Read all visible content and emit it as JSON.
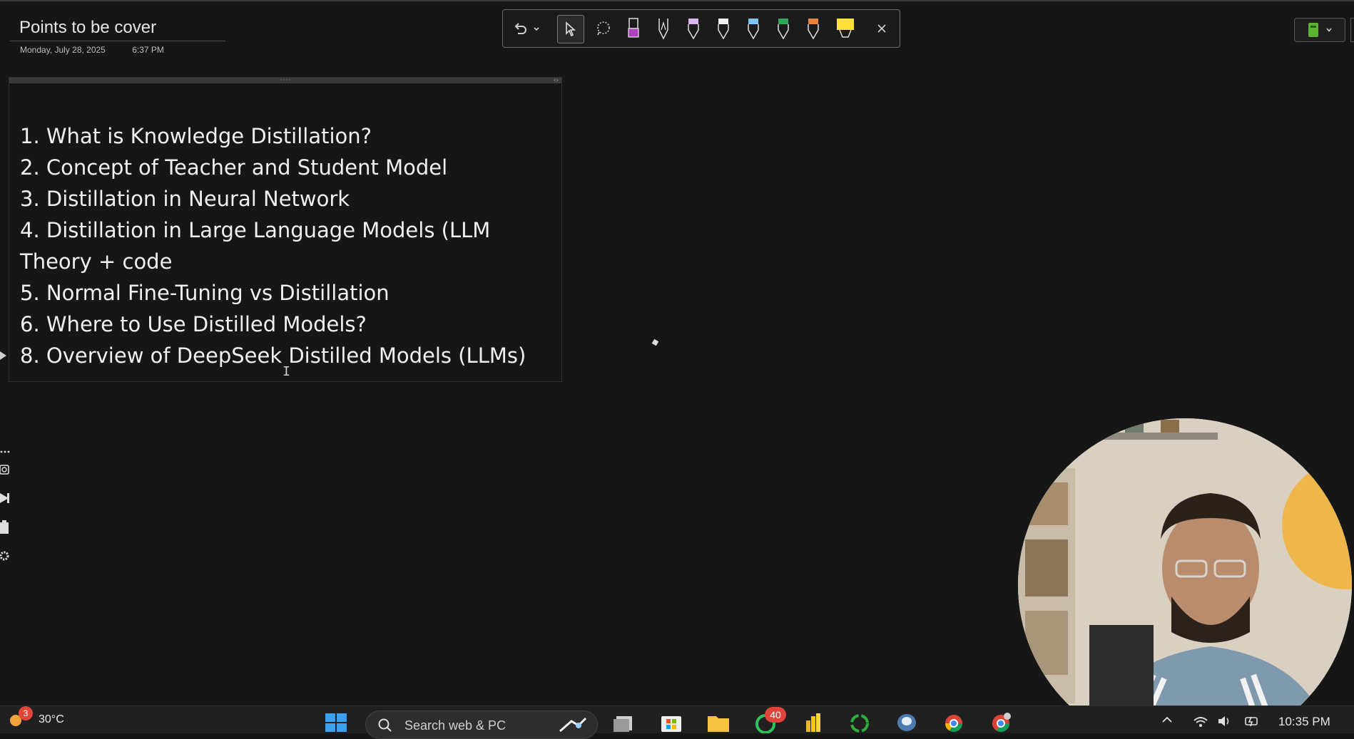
{
  "page": {
    "title": "Points to be cover",
    "date": "Monday, July 28, 2025",
    "time": "6:37 PM"
  },
  "toolbar": {
    "tools": [
      "undo-icon",
      "undo-dropdown-icon",
      "select-cursor-icon",
      "lasso-icon",
      "highlighter-purple",
      "pen-outline",
      "pen-lavender",
      "pen-white",
      "pen-blue",
      "pen-green",
      "pen-orange",
      "highlighter-yellow",
      "close-icon"
    ],
    "colors": {
      "purple": "#b13fbf",
      "lavender": "#d9b6f0",
      "white": "#f2f2f2",
      "blue": "#7fc4f2",
      "green": "#2fa85a",
      "orange": "#e8823a",
      "yellow": "#ffe13a"
    }
  },
  "note": {
    "items": [
      "1. What is Knowledge Distillation?",
      "2. Concept of Teacher and Student Model",
      "3. Distillation in Neural Network",
      "4. Distillation in Large Language Models (LLM",
      "Theory + code",
      "5. Normal Fine-Tuning vs Distillation",
      "6. Where to Use Distilled Models?",
      "8. Overview of DeepSeek Distilled Models (LLMs)"
    ]
  },
  "taskbar": {
    "weather_badge": "3",
    "temperature": "30°C",
    "search_placeholder": "Search web & PC",
    "whatsapp_badge": "40",
    "clock_time": "10:35 PM"
  }
}
